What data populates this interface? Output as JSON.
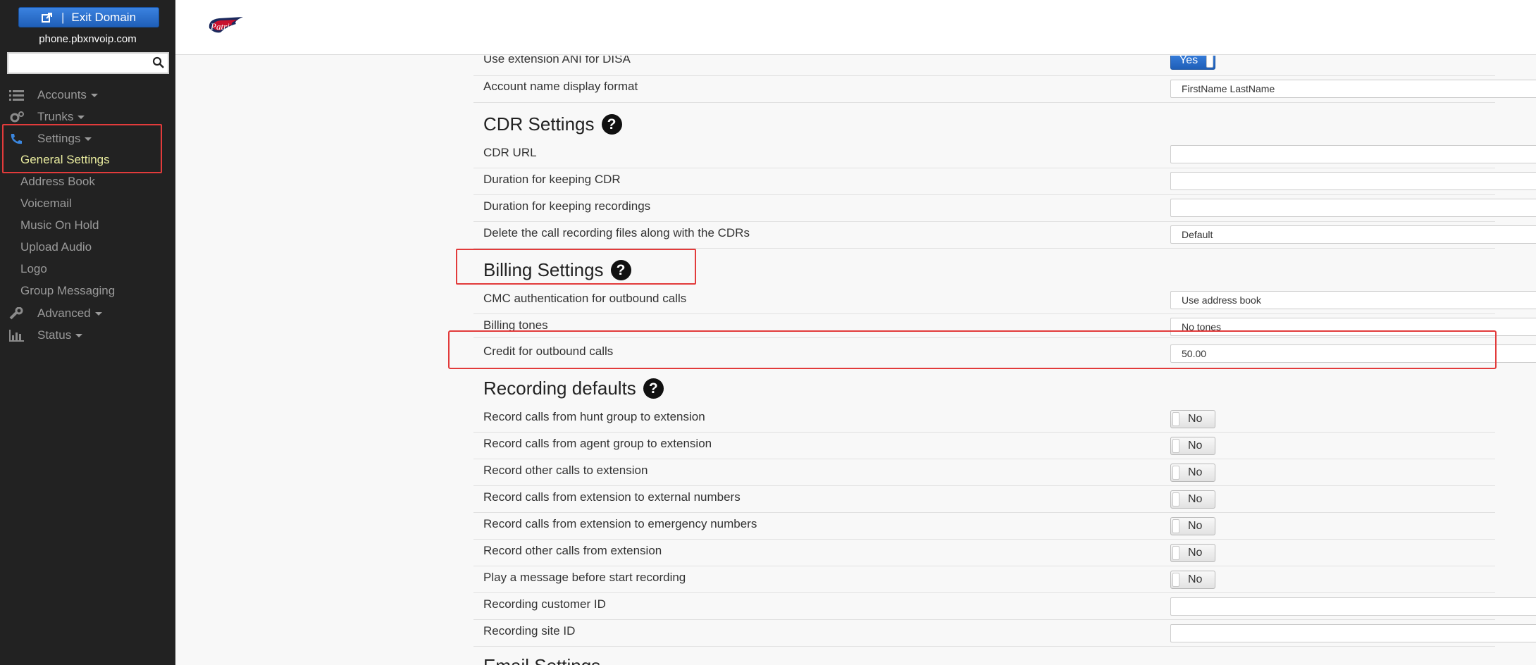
{
  "sidebar": {
    "exit_label": "Exit Domain",
    "domain": "phone.pbxnvoip.com",
    "search_placeholder": "",
    "nav": [
      {
        "label": "Accounts",
        "icon": "list-icon"
      },
      {
        "label": "Trunks",
        "icon": "gears-icon"
      },
      {
        "label": "Settings",
        "icon": "phone-icon"
      },
      {
        "label": "Advanced",
        "icon": "wrench-icon"
      },
      {
        "label": "Status",
        "icon": "bar-chart-icon"
      }
    ],
    "sub_items": [
      "General Settings",
      "Address Book",
      "Voicemail",
      "Music On Hold",
      "Upload Audio",
      "Logo",
      "Group Messaging"
    ]
  },
  "header": {
    "logo_text": "Patriots"
  },
  "colors": {
    "accent": "#2a6fcf",
    "highlight": "#e23b3b",
    "sidebar_bg": "#222222",
    "active_sub": "#e8eb9e"
  },
  "top_rows": [
    {
      "label": "Use extension ANI for DISA",
      "toggle": "Yes"
    },
    {
      "label": "Account name display format",
      "value": "FirstName LastName"
    }
  ],
  "cdr": {
    "title": "CDR Settings",
    "rows": [
      {
        "label": "CDR URL",
        "value": ""
      },
      {
        "label": "Duration for keeping CDR",
        "value": ""
      },
      {
        "label": "Duration for keeping recordings",
        "value": ""
      },
      {
        "label": "Delete the call recording files along with the CDRs",
        "value": "Default"
      }
    ]
  },
  "billing": {
    "title": "Billing Settings",
    "rows": [
      {
        "label": "CMC authentication for outbound calls",
        "value": "Use address book"
      },
      {
        "label": "Billing tones",
        "value": "No tones"
      },
      {
        "label": "Credit for outbound calls",
        "value": "50.00"
      }
    ]
  },
  "recording": {
    "title": "Recording defaults",
    "rows": [
      {
        "label": "Record calls from hunt group to extension",
        "toggle": "No"
      },
      {
        "label": "Record calls from agent group to extension",
        "toggle": "No"
      },
      {
        "label": "Record other calls to extension",
        "toggle": "No"
      },
      {
        "label": "Record calls from extension to external numbers",
        "toggle": "No"
      },
      {
        "label": "Record calls from extension to emergency numbers",
        "toggle": "No"
      },
      {
        "label": "Record other calls from extension",
        "toggle": "No"
      },
      {
        "label": "Play a message before start recording",
        "toggle": "No"
      },
      {
        "label": "Recording customer ID",
        "value": ""
      },
      {
        "label": "Recording site ID",
        "value": ""
      }
    ]
  },
  "next_section_title": "Email Settings"
}
